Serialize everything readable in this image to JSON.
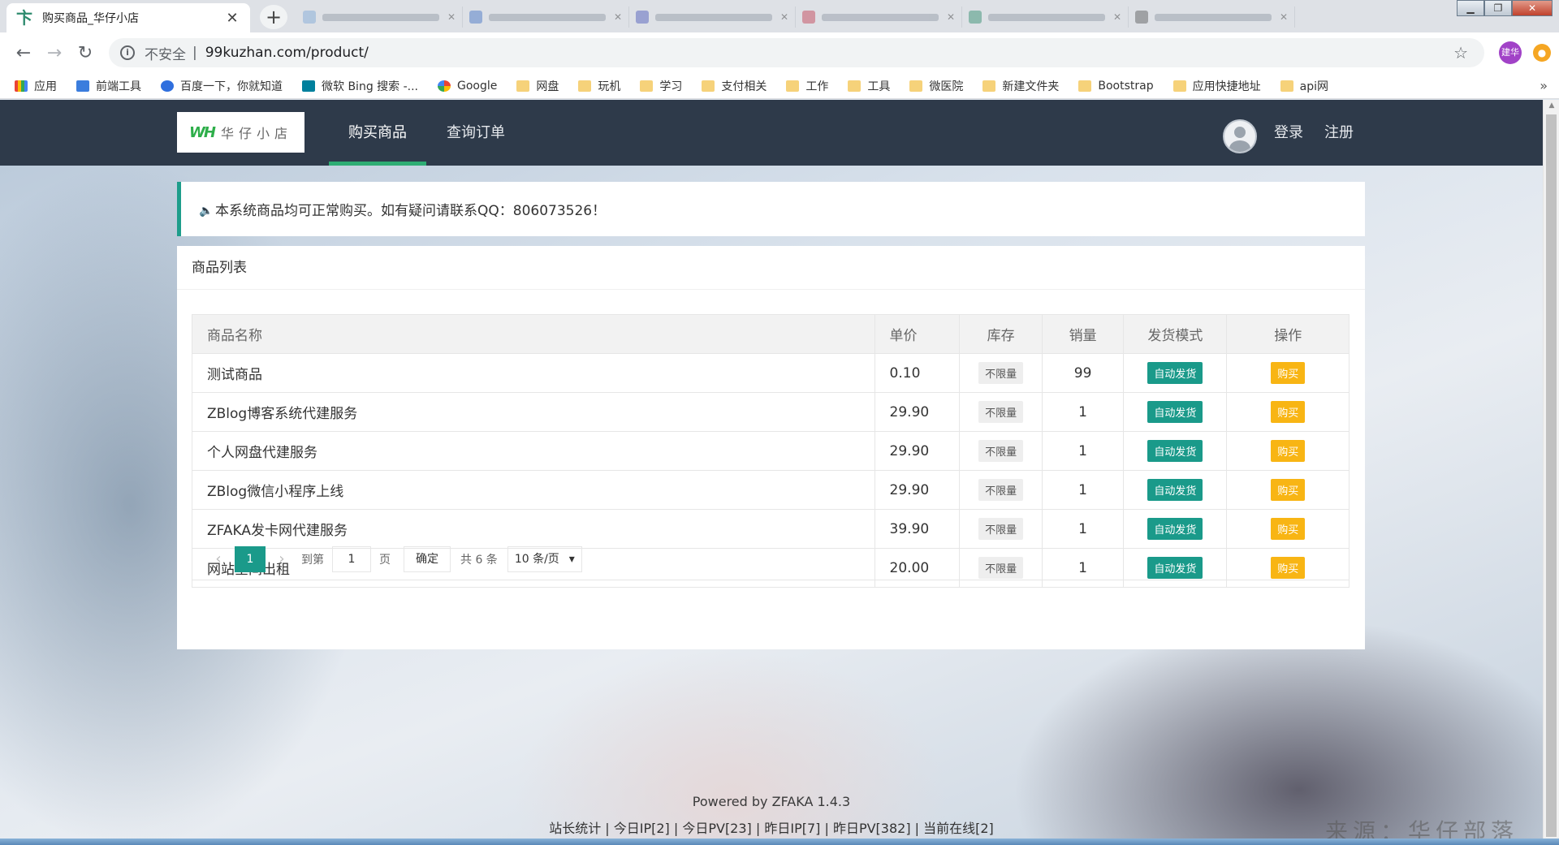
{
  "browser": {
    "active_tab_title": "购买商品_华仔小店",
    "address": {
      "security_label": "不安全",
      "separator": "|",
      "url": "99kuzhan.com/product/"
    },
    "profile_label": "建华",
    "bookmarks": [
      {
        "label": "应用",
        "icon": "apps-icon"
      },
      {
        "label": "前端工具",
        "icon": "bookmark-icon"
      },
      {
        "label": "百度一下，你就知道",
        "icon": "baidu-icon"
      },
      {
        "label": "微软 Bing 搜索 -...",
        "icon": "bing-icon"
      },
      {
        "label": "Google",
        "icon": "google-icon"
      },
      {
        "label": "网盘",
        "icon": "folder-icon"
      },
      {
        "label": "玩机",
        "icon": "folder-icon"
      },
      {
        "label": "学习",
        "icon": "folder-icon"
      },
      {
        "label": "支付相关",
        "icon": "folder-icon"
      },
      {
        "label": "工作",
        "icon": "folder-icon"
      },
      {
        "label": "工具",
        "icon": "folder-icon"
      },
      {
        "label": "微医院",
        "icon": "folder-icon"
      },
      {
        "label": "新建文件夹",
        "icon": "folder-icon"
      },
      {
        "label": "Bootstrap",
        "icon": "folder-icon"
      },
      {
        "label": "应用快捷地址",
        "icon": "folder-icon"
      },
      {
        "label": "api网",
        "icon": "folder-icon"
      }
    ],
    "bookmarks_more": "»"
  },
  "site": {
    "brand_text": "华仔小店",
    "nav": {
      "buy": "购买商品",
      "query": "查询订单",
      "login": "登录",
      "register": "注册"
    },
    "notice": "本系统商品均可正常购买。如有疑问请联系QQ：806073526！",
    "panel_title": "商品列表",
    "table": {
      "headers": [
        "商品名称",
        "单价",
        "库存",
        "销量",
        "发货模式",
        "操作"
      ],
      "rows": [
        {
          "name": "测试商品",
          "price": "0.10",
          "stock": "不限量",
          "sales": "99",
          "mode": "自动发货",
          "action": "购买"
        },
        {
          "name": "ZBlog博客系统代建服务",
          "price": "29.90",
          "stock": "不限量",
          "sales": "1",
          "mode": "自动发货",
          "action": "购买"
        },
        {
          "name": "个人网盘代建服务",
          "price": "29.90",
          "stock": "不限量",
          "sales": "1",
          "mode": "自动发货",
          "action": "购买"
        },
        {
          "name": "ZBlog微信小程序上线",
          "price": "29.90",
          "stock": "不限量",
          "sales": "1",
          "mode": "自动发货",
          "action": "购买"
        },
        {
          "name": "ZFAKA发卡网代建服务",
          "price": "39.90",
          "stock": "不限量",
          "sales": "1",
          "mode": "自动发货",
          "action": "购买"
        },
        {
          "name": "网站空间出租",
          "price": "20.00",
          "stock": "不限量",
          "sales": "1",
          "mode": "自动发货",
          "action": "购买"
        }
      ]
    },
    "pager": {
      "current": "1",
      "goto_label": "到第",
      "page_input": "1",
      "page_label": "页",
      "confirm": "确定",
      "total": "共 6 条",
      "page_size": "10 条/页"
    },
    "footer": {
      "powered": "Powered by ZFAKA 1.4.3",
      "stats": "站长统计 | 今日IP[2] | 今日PV[23] | 昨日IP[7] | 昨日PV[382] | 当前在线[2]"
    },
    "watermark": "来源：华仔部落"
  },
  "colors": {
    "navbar": "#2e3a4a",
    "accent": "#1a9a8a",
    "buy_button": "#f8b514",
    "active_underline": "#2ead74"
  }
}
